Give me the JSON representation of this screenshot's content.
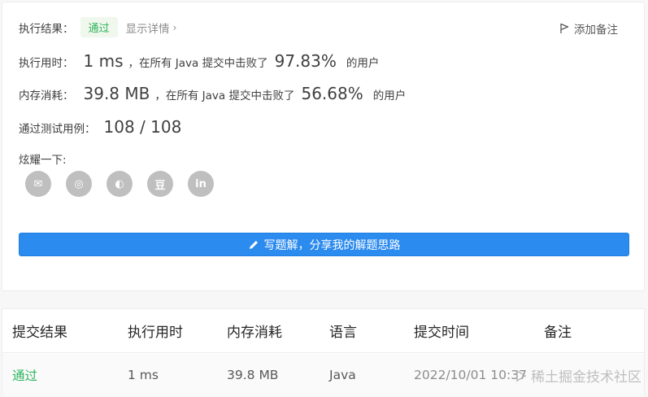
{
  "result": {
    "label": "执行结果：",
    "status": "通过",
    "details_link": "显示详情",
    "details_chevron": "›",
    "add_note": "添加备注"
  },
  "runtime": {
    "label": "执行用时：",
    "value": "1 ms",
    "middle": "，在所有 Java 提交中击败了",
    "percent": "97.83%",
    "suffix": "的用户"
  },
  "memory": {
    "label": "内存消耗：",
    "value": "39.8 MB",
    "middle": "，在所有 Java 提交中击败了",
    "percent": "56.68%",
    "suffix": "的用户"
  },
  "testcases": {
    "label": "通过测试用例：",
    "value": "108 / 108"
  },
  "share": {
    "label": "炫耀一下:",
    "icons": [
      {
        "name": "wechat-icon",
        "glyph": "✉"
      },
      {
        "name": "weibo-icon",
        "glyph": "◎"
      },
      {
        "name": "qq-icon",
        "glyph": "◐"
      },
      {
        "name": "douban-icon",
        "glyph": "豆"
      },
      {
        "name": "linkedin-icon",
        "glyph": "in"
      }
    ]
  },
  "write_solution": "写题解，分享我的解题思路",
  "table": {
    "headers": [
      "提交结果",
      "执行用时",
      "内存消耗",
      "语言",
      "提交时间",
      "备注"
    ],
    "rows": [
      {
        "status": "通过",
        "runtime": "1 ms",
        "memory": "39.8 MB",
        "language": "Java",
        "time": "2022/10/01 10:37",
        "note": ""
      }
    ]
  },
  "watermark": "稀土掘金技术社区",
  "colors": {
    "accent": "#2c8bef",
    "success": "#2db55d",
    "muted": "#8c8c8c",
    "icon_gray": "#bfbfbf"
  }
}
